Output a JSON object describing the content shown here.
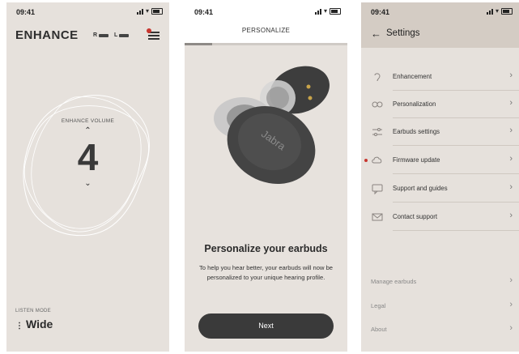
{
  "status": {
    "time": "09:41"
  },
  "enhance": {
    "title": "ENHANCE",
    "right_bud": "R",
    "left_bud": "L",
    "volume_label": "ENHANCE VOLUME",
    "volume_up_icon": "chevron-up-icon",
    "volume_value": "4",
    "volume_down_icon": "chevron-down-icon",
    "listen_mode_label": "LISTEN MODE",
    "listen_mode_value": "Wide"
  },
  "personalize": {
    "header_title": "PERSONALIZE",
    "progress_fraction": 0.17,
    "earbud_brand": "Jabra",
    "heading": "Personalize your earbuds",
    "body": "To help you hear better, your earbuds will now be personalized to your unique hearing profile.",
    "next_label": "Next"
  },
  "settings": {
    "title": "Settings",
    "items": [
      {
        "label": "Enhancement",
        "icon": "ear-icon"
      },
      {
        "label": "Personalization",
        "icon": "personalization-icon"
      },
      {
        "label": "Earbuds settings",
        "icon": "sliders-icon"
      },
      {
        "label": "Firmware update",
        "icon": "cloud-icon",
        "notification": true
      },
      {
        "label": "Support and guides",
        "icon": "chat-icon"
      },
      {
        "label": "Contact support",
        "icon": "mail-icon"
      }
    ],
    "secondary_items": [
      {
        "label": "Manage earbuds"
      },
      {
        "label": "Legal"
      },
      {
        "label": "About"
      }
    ]
  },
  "colors": {
    "background": "#e6e1dc",
    "button": "#3a3a3a",
    "notification": "#c8362f",
    "settings_header": "#d4ccc4"
  }
}
